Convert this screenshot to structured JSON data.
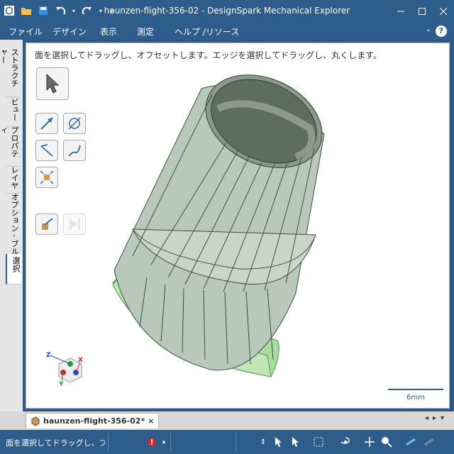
{
  "window": {
    "title": "haunzen-flight-356-02 - DesignSpark Mechanical Explorer"
  },
  "menu": {
    "items": [
      "ファイル",
      "デザイン",
      "表示",
      "測定",
      "ヘルプ /リソース"
    ],
    "help": "?"
  },
  "sidebar": {
    "tabs": [
      "ストラクチャー",
      "ビュー",
      "プロパティ",
      "レイヤ",
      "オプション - ブル",
      "選択"
    ]
  },
  "viewport": {
    "hint": "面を選択してドラッグし、オフセットします。エッジを選択してドラッグし、丸くします。",
    "scale_label": "6mm",
    "triad": {
      "x": "X",
      "y": "Y",
      "z": "Z"
    }
  },
  "doc_tab": {
    "label": "haunzen-flight-356-02*",
    "close": "×"
  },
  "status": {
    "message": "面を選択してドラッグし、フ"
  },
  "colors": {
    "accent": "#2e5d8c",
    "model": "#b8c8b8",
    "base_ring": "#a8dca0"
  }
}
